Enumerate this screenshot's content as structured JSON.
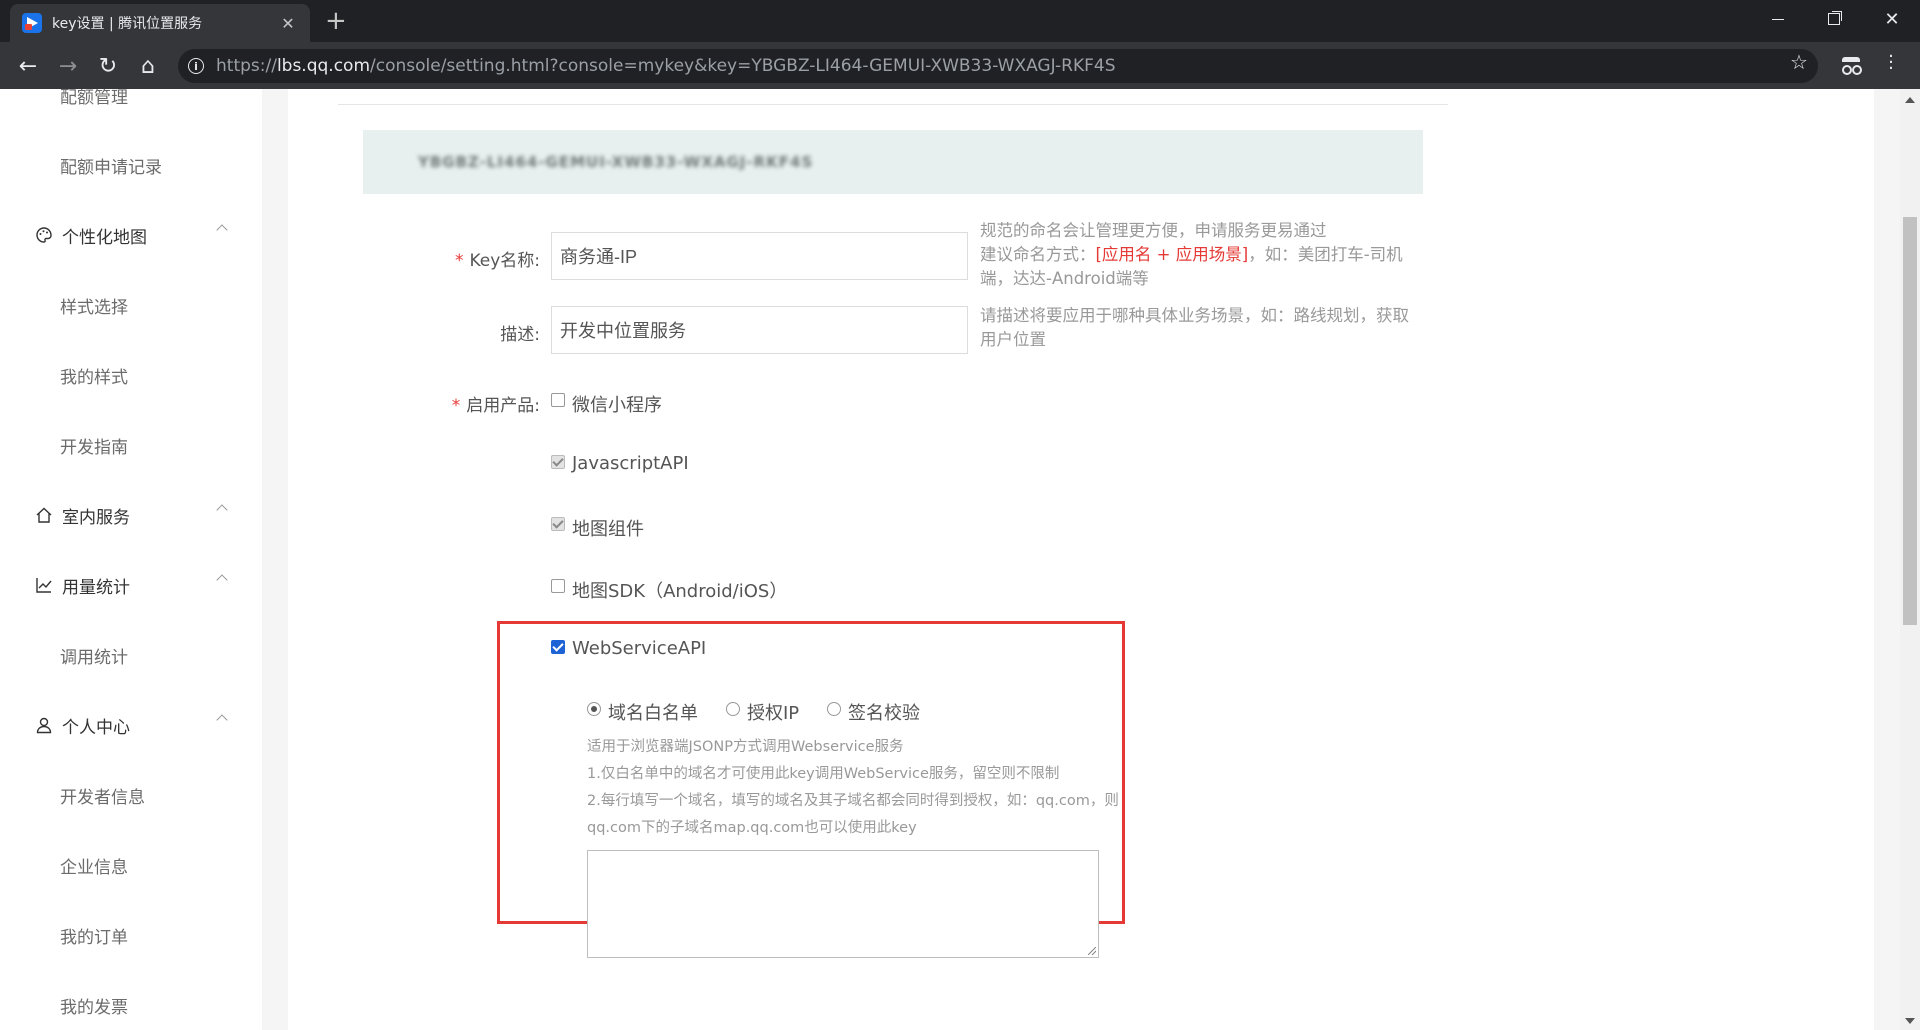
{
  "browser": {
    "tab_title": "key设置 | 腾讯位置服务",
    "url_scheme": "https://",
    "url_host": "lbs.qq.com",
    "url_path": "/console/setting.html?console=mykey&key=YBGBZ-LI464-GEMUI-XWB33-WXAGJ-RKF4S"
  },
  "sidebar": {
    "items": [
      {
        "type": "sub",
        "label": "配额管理"
      },
      {
        "type": "sub",
        "label": "配额申请记录"
      },
      {
        "type": "group",
        "label": "个性化地图",
        "icon": "palette-icon"
      },
      {
        "type": "sub",
        "label": "样式选择"
      },
      {
        "type": "sub",
        "label": "我的样式"
      },
      {
        "type": "sub",
        "label": "开发指南"
      },
      {
        "type": "group",
        "label": "室内服务",
        "icon": "home-icon"
      },
      {
        "type": "group",
        "label": "用量统计",
        "icon": "chart-line-icon"
      },
      {
        "type": "sub",
        "label": "调用统计"
      },
      {
        "type": "group",
        "label": "个人中心",
        "icon": "user-icon"
      },
      {
        "type": "sub",
        "label": "开发者信息"
      },
      {
        "type": "sub",
        "label": "企业信息"
      },
      {
        "type": "sub",
        "label": "我的订单"
      },
      {
        "type": "sub",
        "label": "我的发票"
      }
    ]
  },
  "form": {
    "key_display": "YBGBZ-LI464-GEMUI-XWB33-WXAGJ-RKF4S",
    "name_label": "Key名称:",
    "name_value": "商务通-IP",
    "name_hint_line1": "规范的命名会让管理更方便，申请服务更易通过",
    "name_hint_prefix": "建议命名方式：",
    "name_hint_red": "[应用名 + 应用场景]",
    "name_hint_suffix": "，如：美团打车-司机端，达达-Android端等",
    "desc_label": "描述:",
    "desc_value": "开发中位置服务",
    "desc_hint": "请描述将要应用于哪种具体业务场景，如：路线规划，获取用户位置",
    "products_label": "启用产品:",
    "products": [
      {
        "label": "微信小程序",
        "state": "unchecked"
      },
      {
        "label": "JavascriptAPI",
        "state": "checked-disabled"
      },
      {
        "label": "地图组件",
        "state": "checked-disabled"
      },
      {
        "label": "地图SDK（Android/iOS）",
        "state": "unchecked"
      },
      {
        "label": "WebServiceAPI",
        "state": "checked"
      }
    ],
    "webservice": {
      "radios": [
        {
          "label": "域名白名单",
          "selected": true
        },
        {
          "label": "授权IP",
          "selected": false
        },
        {
          "label": "签名校验",
          "selected": false
        }
      ],
      "desc_lines": [
        "适用于浏览器端JSONP方式调用Webservice服务",
        "1.仅白名单中的域名才可使用此key调用WebService服务，留空则不限制",
        "2.每行填写一个域名，填写的域名及其子域名都会同时得到授权，如：qq.com，则",
        "qq.com下的子域名map.qq.com也可以使用此key"
      ],
      "textarea_value": ""
    }
  }
}
